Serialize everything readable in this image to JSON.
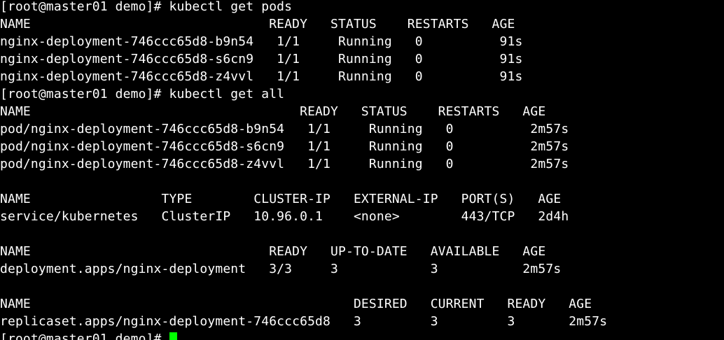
{
  "terminal": {
    "lines": [
      "[root@master01 demo]# kubectl get pods",
      "NAME                               READY   STATUS    RESTARTS   AGE",
      "nginx-deployment-746ccc65d8-b9n54   1/1     Running   0          91s",
      "nginx-deployment-746ccc65d8-s6cn9   1/1     Running   0          91s",
      "nginx-deployment-746ccc65d8-z4vvl   1/1     Running   0          91s",
      "[root@master01 demo]# kubectl get all",
      "NAME                                   READY   STATUS    RESTARTS   AGE",
      "pod/nginx-deployment-746ccc65d8-b9n54   1/1     Running   0          2m57s",
      "pod/nginx-deployment-746ccc65d8-s6cn9   1/1     Running   0          2m57s",
      "pod/nginx-deployment-746ccc65d8-z4vvl   1/1     Running   0          2m57s",
      "",
      "NAME                 TYPE        CLUSTER-IP   EXTERNAL-IP   PORT(S)   AGE",
      "service/kubernetes   ClusterIP   10.96.0.1    <none>        443/TCP   2d4h",
      "",
      "NAME                               READY   UP-TO-DATE   AVAILABLE   AGE",
      "deployment.apps/nginx-deployment   3/3     3            3           2m57s",
      "",
      "NAME                                          DESIRED   CURRENT   READY   AGE",
      "replicaset.apps/nginx-deployment-746ccc65d8   3         3         3       2m57s"
    ],
    "prompt": "[root@master01 demo]# "
  },
  "colors": {
    "background": "#000000",
    "text": "#ffffff",
    "cursor": "#00ff00"
  }
}
